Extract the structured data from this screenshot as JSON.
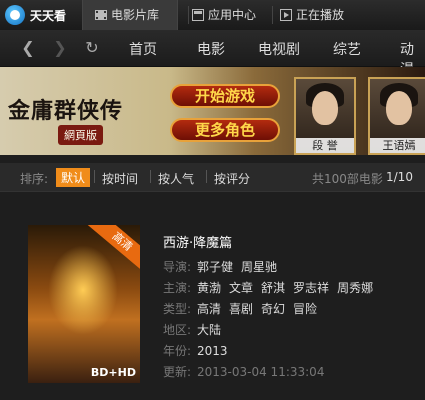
{
  "titlebar": {
    "app_name": "天天看",
    "tabs": [
      {
        "label": "电影片库",
        "icon": "film-icon"
      },
      {
        "label": "应用中心",
        "icon": "app-icon"
      },
      {
        "label": "正在播放",
        "icon": "play-icon"
      }
    ]
  },
  "nav": {
    "items": [
      "首页",
      "电影",
      "电视剧",
      "综艺",
      "动漫"
    ]
  },
  "banner": {
    "title": "金庸群侠传",
    "subtitle": "網頁版",
    "play_label": "开始游戏",
    "more_label": "更多角色",
    "characters": [
      "段 誉",
      "王语嫣"
    ]
  },
  "sortbar": {
    "label": "排序:",
    "options": [
      "默认",
      "按时间",
      "按人气",
      "按评分"
    ],
    "total": "共100部电影",
    "page": "1/10"
  },
  "movie": {
    "title": "西游·降魔篇",
    "poster_badge": "高清",
    "poster_quality": "BD+HD",
    "director_label": "导演:",
    "directors": [
      "郭子健",
      "周星驰"
    ],
    "cast_label": "主演:",
    "cast": [
      "黄渤",
      "文章",
      "舒淇",
      "罗志祥",
      "周秀娜"
    ],
    "genre_label": "类型:",
    "genres": [
      "高清",
      "喜剧",
      "奇幻",
      "冒险"
    ],
    "region_label": "地区:",
    "region": "大陆",
    "year_label": "年份:",
    "year": "2013",
    "updated_label": "更新:",
    "updated": "2013-03-04 11:33:04"
  },
  "colors": {
    "accent": "#f08c1a",
    "background": "#1e1e1e"
  }
}
